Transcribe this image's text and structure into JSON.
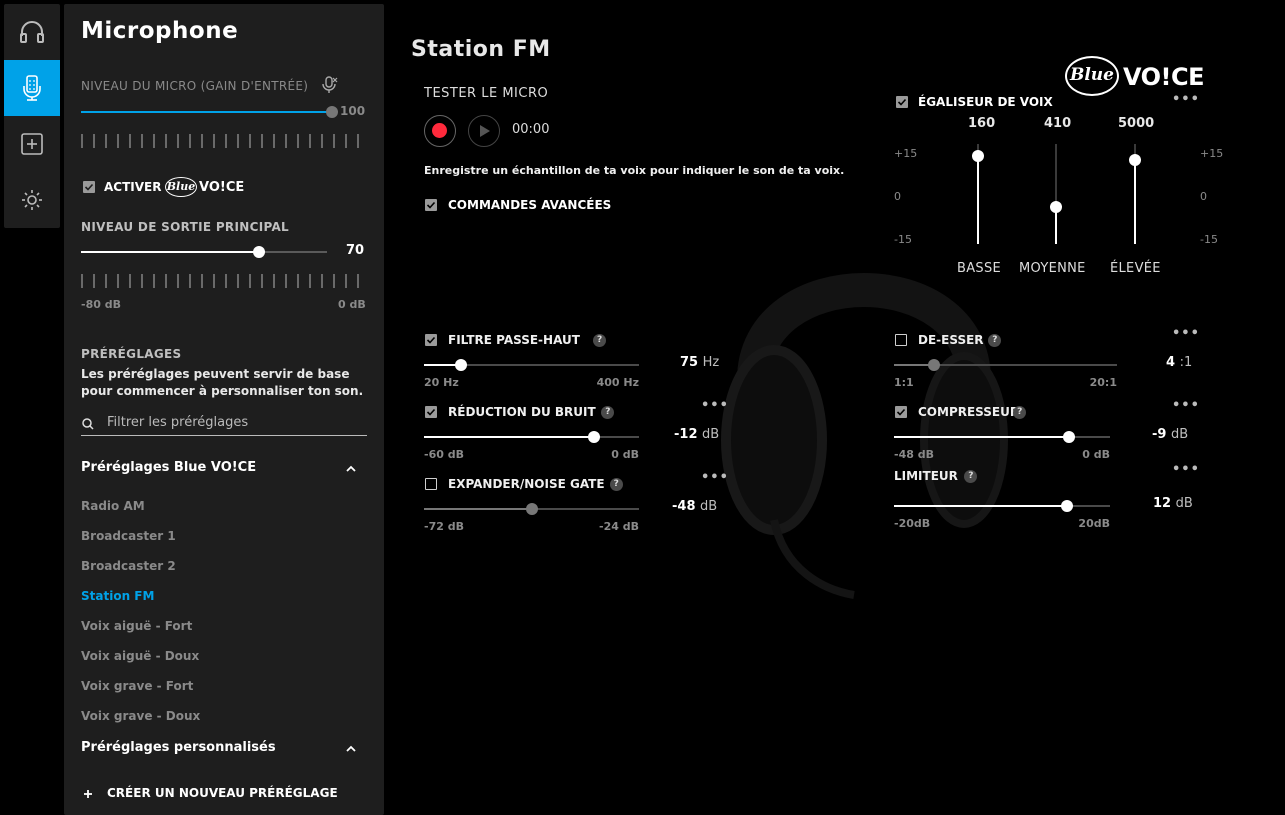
{
  "nav": [
    {
      "name": "headset-icon",
      "active": false
    },
    {
      "name": "microphone-icon",
      "active": true
    },
    {
      "name": "add-icon",
      "active": false
    },
    {
      "name": "settings-icon",
      "active": false
    }
  ],
  "panel": {
    "title": "Microphone",
    "mic_gain_label": "NIVEAU DU MICRO (GAIN D'ENTRÉE)",
    "mic_gain_value": "100",
    "enable_label": "ACTIVER",
    "blue_logo_text": "Blue",
    "voice_logo_text": "VO!CE",
    "output_label": "NIVEAU DE SORTIE PRINCIPAL",
    "output_value": "70",
    "output_min": "-80 dB",
    "output_max": "0 dB",
    "presets_heading": "PRÉRÉGLAGES",
    "presets_desc": "Les préréglages peuvent servir de base pour commencer à personnaliser ton son.",
    "filter_placeholder": "Filtrer les préréglages",
    "blue_presets_title": "Préréglages Blue VO!CE",
    "presets": [
      "Radio AM",
      "Broadcaster 1",
      "Broadcaster 2",
      "Station FM",
      "Voix aiguë - Fort",
      "Voix aiguë - Doux",
      "Voix grave - Fort",
      "Voix grave - Doux"
    ],
    "selected_preset_index": 3,
    "custom_presets_title": "Préréglages personnalisés",
    "create_label": "CRÉER UN NOUVEAU PRÉRÉGLAGE"
  },
  "main": {
    "title": "Station FM",
    "test_mic_label": "TESTER LE MICRO",
    "timer": "00:00",
    "record_desc": "Enregistre un échantillon de ta voix pour indiquer le son de ta voix.",
    "advanced_label": "COMMANDES AVANCÉES",
    "logo_blue": "Blue",
    "logo_voice": "VO!CE",
    "eq": {
      "label": "ÉGALISEUR DE VOIX",
      "more": "•••",
      "scale": [
        "+15",
        "0",
        "-15"
      ],
      "bands": [
        {
          "freq": "160",
          "name": "BASSE",
          "level": 0.88
        },
        {
          "freq": "410",
          "name": "MOYENNE",
          "level": 0.37
        },
        {
          "freq": "5000",
          "name": "ÉLEVÉE",
          "level": 0.84
        }
      ]
    },
    "highpass": {
      "label": "FILTRE PASSE-HAUT",
      "checked": true,
      "value": "75",
      "unit": "Hz",
      "min": "20 Hz",
      "max": "400 Hz",
      "level": 0.17
    },
    "noise": {
      "label": "RÉDUCTION DU BRUIT",
      "checked": true,
      "value": "-12",
      "unit": "dB",
      "min": "-60 dB",
      "max": "0 dB",
      "level": 0.79
    },
    "expander": {
      "label": "EXPANDER/NOISE GATE",
      "checked": false,
      "value": "-48",
      "unit": "dB",
      "min": "-72 dB",
      "max": "-24 dB",
      "level": 0.5
    },
    "deesser": {
      "label": "DE-ESSER",
      "checked": false,
      "value": "4",
      "unit": ":1",
      "min": "1:1",
      "max": "20:1",
      "level": 0.18
    },
    "compressor": {
      "label": "COMPRESSEUR",
      "checked": true,
      "value": "-9",
      "unit": "dB",
      "min": "-48 dB",
      "max": "0 dB",
      "level": 0.81
    },
    "limiter": {
      "label": "LIMITEUR",
      "value": "12",
      "unit": "dB",
      "min": "-20dB",
      "max": "20dB",
      "level": 0.8
    },
    "more": "•••",
    "help": "?"
  }
}
